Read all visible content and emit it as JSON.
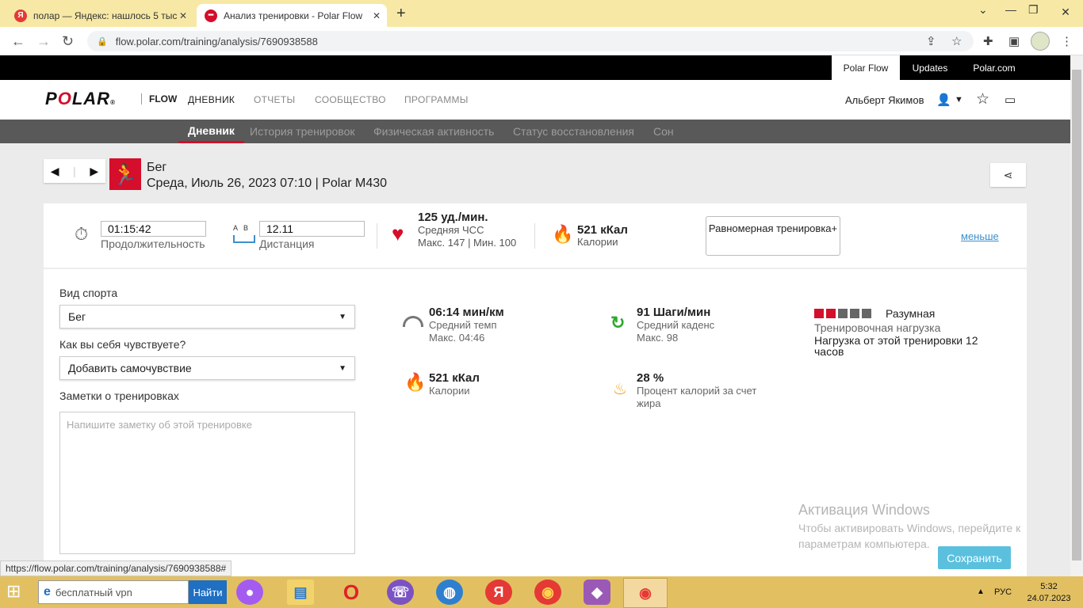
{
  "browser": {
    "tabs": [
      {
        "label": "полар — Яндекс: нашлось 5 тыс",
        "icon": "yandex-icon",
        "active": false
      },
      {
        "label": "Анализ тренировки - Polar Flow",
        "icon": "polar-icon",
        "active": true
      }
    ],
    "url": "flow.polar.com/training/analysis/7690938588",
    "status_url": "https://flow.polar.com/training/analysis/7690938588#"
  },
  "header": {
    "top_links": [
      "Polar Flow",
      "Updates",
      "Polar.com"
    ],
    "logo": "POLAR",
    "product": "FLOW",
    "nav": [
      "ДНЕВНИК",
      "ОТЧЕТЫ",
      "СООБЩЕСТВО",
      "ПРОГРАММЫ"
    ],
    "user_name": "Альберт Якимов",
    "subnav": [
      "Дневник",
      "История тренировок",
      "Физическая активность",
      "Статус восстановления",
      "Сон"
    ]
  },
  "session": {
    "sport": "Бег",
    "info": "Среда, Июль 26, 2023 07:10 | Polar M430"
  },
  "summary": {
    "duration_value": "01:15:42",
    "duration_label": "Продолжительность",
    "distance_ab": "A   B",
    "distance_value": "12.11",
    "distance_label": "Дистанция",
    "hr_value": "125 уд./мин.",
    "hr_label": "Средняя ЧСС",
    "hr_maxmin": "Макс. 147  |  Мин. 100",
    "cal_value": "521 кКал",
    "cal_label": "Калории",
    "program_label": "Равномерная тренировка+",
    "less_link": "меньше"
  },
  "details": {
    "sport_label": "Вид спорта",
    "sport_value": "Бег",
    "feeling_label": "Как вы себя чувствуете?",
    "feeling_value": "Добавить самочувствие",
    "notes_label": "Заметки о тренировках",
    "notes_placeholder": "Напишите заметку об этой тренировке",
    "pace_value": "06:14 мин/км",
    "pace_label": "Средний темп",
    "pace_max": "Макс. 04:46",
    "cadence_value": "91 Шаги/мин",
    "cadence_label": "Средний каденс",
    "cadence_max": "Макс. 98",
    "cal2_value": "521 кКал",
    "cal2_label": "Калории",
    "fat_value": "28 %",
    "fat_label": "Процент калорий за счет жира",
    "load_level": "Разумная",
    "load_level_filled": 2,
    "load_level_total": 5,
    "load_label": "Тренировочная нагрузка",
    "load_desc": "Нагрузка от этой тренировки 12 часов"
  },
  "watermark": {
    "title": "Активация Windows",
    "text": "Чтобы активировать Windows, перейдите к параметрам компьютера."
  },
  "save_label": "Сохранить",
  "taskbar": {
    "search_text": "бесплатный vpn",
    "search_button": "Найти",
    "lang": "РУС",
    "time": "5:32",
    "date": "24.07.2023"
  },
  "colors": {
    "polar_red": "#d40e2b",
    "link_blue": "#3d8fcc",
    "save_blue": "#5bc0de"
  }
}
